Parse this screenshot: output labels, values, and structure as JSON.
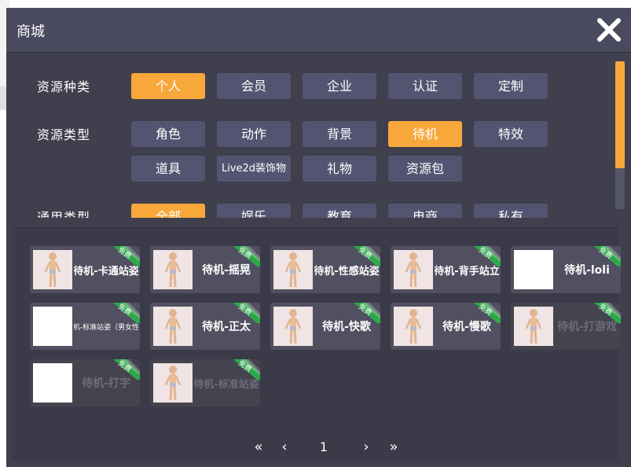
{
  "window": {
    "title": "商城"
  },
  "filters": {
    "resource_kind": {
      "label": "资源种类",
      "options": [
        "个人",
        "会员",
        "企业",
        "认证",
        "定制"
      ],
      "selected": 0
    },
    "resource_type": {
      "label": "资源类型",
      "options": [
        "角色",
        "动作",
        "背景",
        "待机",
        "特效",
        "道具",
        "Live2d装饰物",
        "礼物",
        "资源包"
      ],
      "selected": 3
    },
    "general_type": {
      "label": "通用类型",
      "options": [
        "全部",
        "娱乐",
        "教育",
        "电商",
        "私有"
      ],
      "selected": 0
    }
  },
  "items": [
    {
      "name": "待机-卡通站姿",
      "badge": "免费",
      "thumb": "figure"
    },
    {
      "name": "待机-摇晃",
      "badge": "免费",
      "thumb": "figure"
    },
    {
      "name": "待机-性感站姿",
      "badge": "免费",
      "thumb": "figure"
    },
    {
      "name": "待机-背手站立",
      "badge": "免费",
      "thumb": "figure"
    },
    {
      "name": "待机-loli",
      "badge": "免费",
      "thumb": "blank"
    },
    {
      "name": "待机-标准站姿（男女性）",
      "badge": "免费",
      "thumb": "blank"
    },
    {
      "name": "待机-正太",
      "badge": "免费",
      "thumb": "figure"
    },
    {
      "name": "待机-快歌",
      "badge": "免费",
      "thumb": "figure"
    },
    {
      "name": "待机-慢歌",
      "badge": "免费",
      "thumb": "figure"
    },
    {
      "name": "待机-打游戏",
      "badge": "免费",
      "thumb": "figure"
    },
    {
      "name": "待机-打字",
      "badge": "免费",
      "thumb": "blank"
    },
    {
      "name": "待机-标准站姿",
      "badge": "免费",
      "thumb": "figure"
    }
  ],
  "pagination": {
    "first": "«",
    "prev": "‹",
    "current": "1",
    "next": "›",
    "last": "»"
  },
  "colors": {
    "accent": "#f8a83b",
    "chip": "#545472",
    "panel": "#3f3f4d",
    "badge": "#2fa84a"
  }
}
